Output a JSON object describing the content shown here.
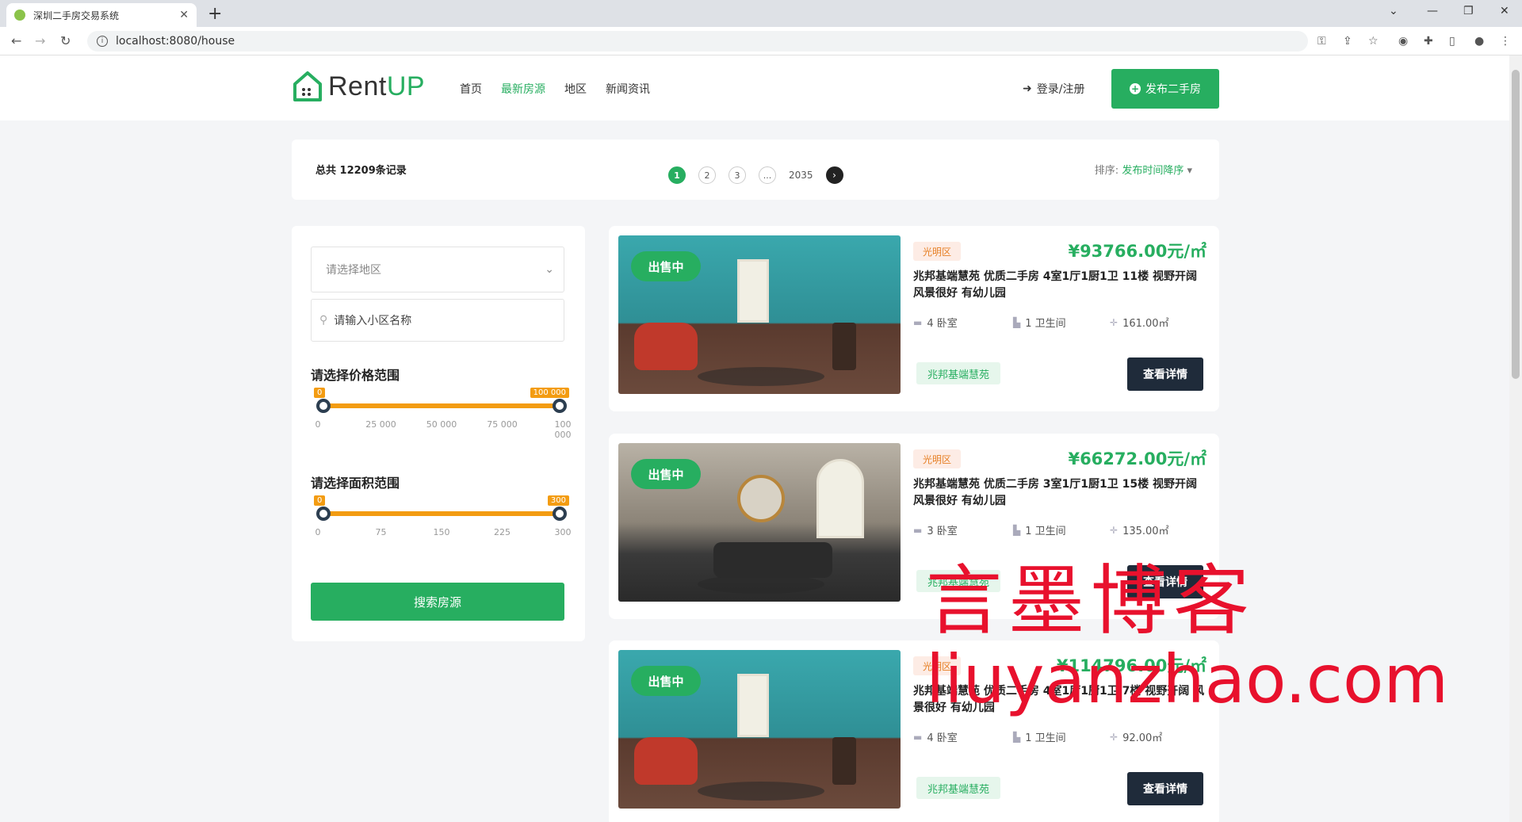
{
  "browser": {
    "tab_title": "深圳二手房交易系统",
    "url": "localhost:8080/house"
  },
  "header": {
    "logo_main": "Rent",
    "logo_accent": "UP",
    "nav": [
      "首页",
      "最新房源",
      "地区",
      "新闻资讯"
    ],
    "active_nav": "最新房源",
    "login_label": "登录/注册",
    "publish_label": "发布二手房"
  },
  "summary": {
    "total_label": "总共 12209条记录",
    "pages": [
      "1",
      "2",
      "3",
      "...",
      "2035"
    ],
    "sort_label": "排序:",
    "sort_value": "发布时间降序"
  },
  "filters": {
    "region_placeholder": "请选择地区",
    "community_placeholder": "请输入小区名称",
    "price_title": "请选择价格范围",
    "price_min_label": "0",
    "price_max_label": "100 000",
    "price_ticks": [
      "0",
      "25 000",
      "50 000",
      "75 000",
      "100 000"
    ],
    "area_title": "请选择面积范围",
    "area_min_label": "0",
    "area_max_label": "300",
    "area_ticks": [
      "0",
      "75",
      "150",
      "225",
      "300"
    ],
    "search_button": "搜索房源"
  },
  "listings": [
    {
      "status": "出售中",
      "district": "光明区",
      "price": "¥93766.00元/㎡",
      "title": "兆邦基端慧苑 优质二手房 4室1厅1厨1卫 11楼 视野开阔 风景很好 有幼儿园",
      "bedrooms": "4 卧室",
      "bathrooms": "1 卫生间",
      "area": "161.00㎡",
      "community": "兆邦基端慧苑",
      "detail_button": "查看详情"
    },
    {
      "status": "出售中",
      "district": "光明区",
      "price": "¥66272.00元/㎡",
      "title": "兆邦基端慧苑 优质二手房 3室1厅1厨1卫 15楼 视野开阔 风景很好 有幼儿园",
      "bedrooms": "3 卧室",
      "bathrooms": "1 卫生间",
      "area": "135.00㎡",
      "community": "兆邦基端慧苑",
      "detail_button": "查看详情"
    },
    {
      "status": "出售中",
      "district": "光明区",
      "price": "¥114796.00元/㎡",
      "title": "兆邦基端慧苑 优质二手房 4室1厅1厨1卫 7楼 视野开阔 风景很好 有幼儿园",
      "bedrooms": "4 卧室",
      "bathrooms": "1 卫生间",
      "area": "92.00㎡",
      "community": "兆邦基端慧苑",
      "detail_button": "查看详情"
    }
  ],
  "watermark": {
    "cn": "言墨博客",
    "en": "liuyanzhao.com"
  },
  "colors": {
    "accent": "#27ae60",
    "slider": "#f39c12",
    "dark_button": "#1f2b3a",
    "watermark": "#e8112d"
  }
}
